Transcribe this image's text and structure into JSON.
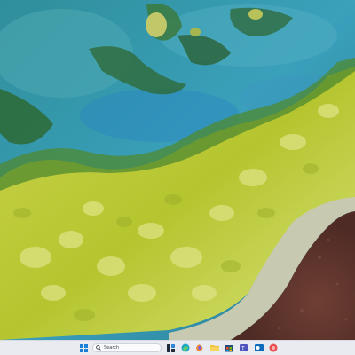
{
  "desktop": {
    "wallpaper_name": "aerial-landscape-wallpaper"
  },
  "taskbar": {
    "background_color": "#e9ebf1",
    "search": {
      "placeholder": "Search",
      "icon": "search-icon"
    },
    "start_icon": "windows-start-icon",
    "pinned_apps": [
      {
        "name": "widgets",
        "icon": "widgets-icon"
      },
      {
        "name": "edge",
        "icon": "edge-browser-icon"
      },
      {
        "name": "copilot",
        "icon": "copilot-icon"
      },
      {
        "name": "file-explorer",
        "icon": "folder-icon"
      },
      {
        "name": "store",
        "icon": "store-icon"
      },
      {
        "name": "teams",
        "icon": "teams-icon"
      },
      {
        "name": "outlook",
        "icon": "outlook-icon"
      },
      {
        "name": "skype",
        "icon": "skype-icon"
      },
      {
        "name": "app",
        "icon": "red-app-icon"
      }
    ]
  }
}
